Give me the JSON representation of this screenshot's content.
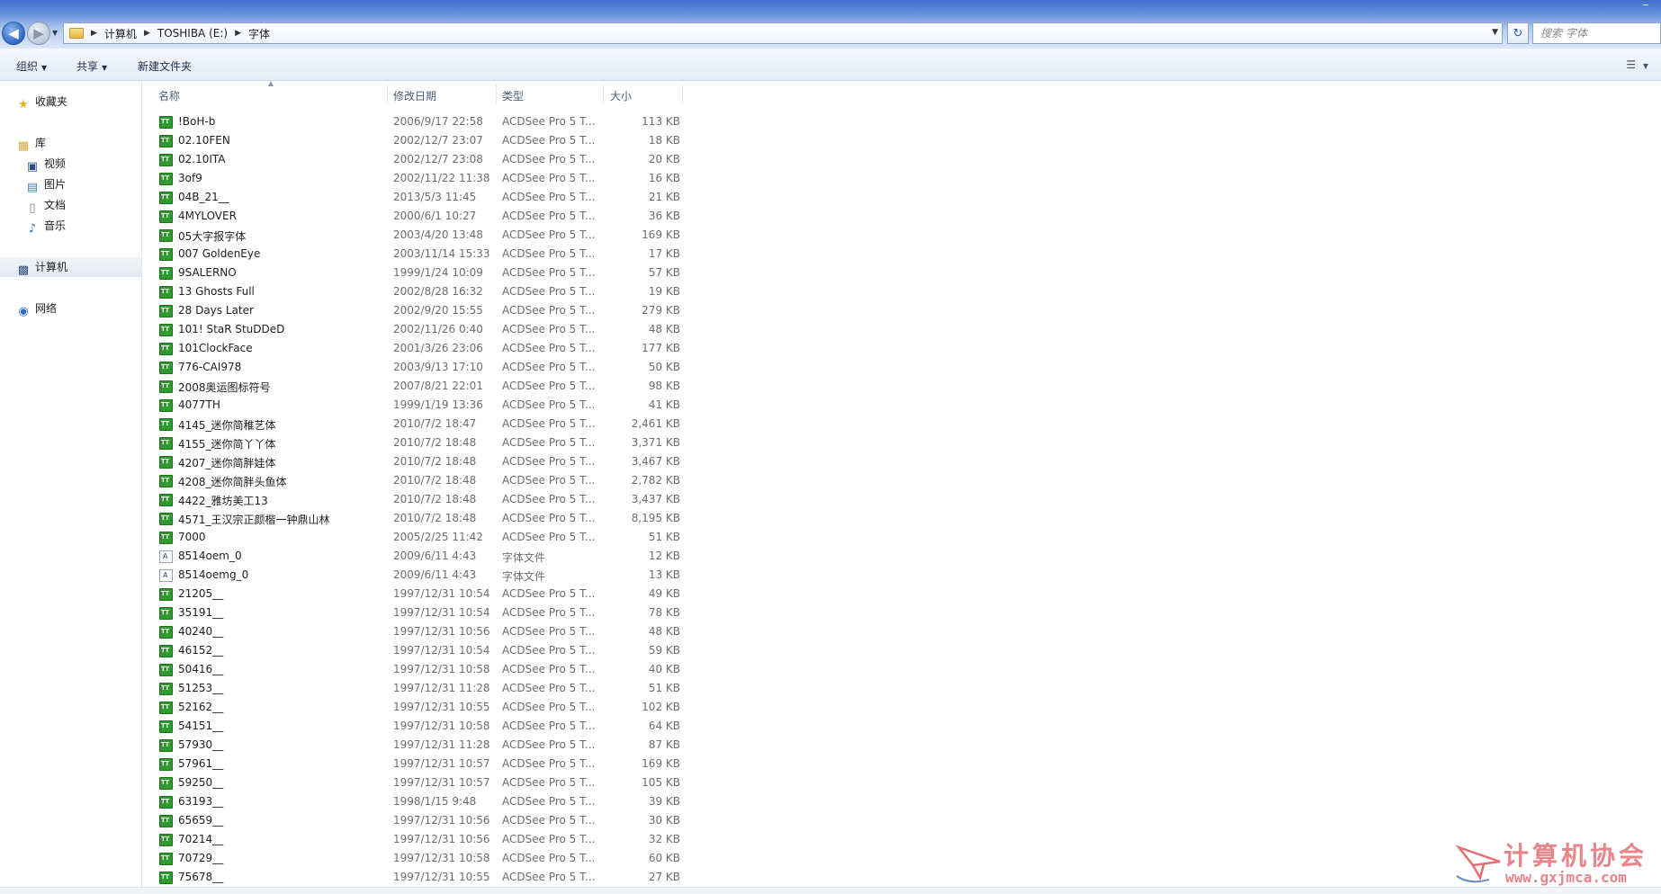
{
  "address": {
    "crumbs": [
      "计算机",
      "TOSHIBA (E:)",
      "字体"
    ],
    "search_placeholder": "搜索 字体"
  },
  "toolbar": {
    "organize": "组织",
    "share": "共享",
    "new_folder": "新建文件夹"
  },
  "nav": {
    "favorites": "收藏夹",
    "libraries": "库",
    "videos": "视频",
    "pictures": "图片",
    "documents": "文档",
    "music": "音乐",
    "computer": "计算机",
    "network": "网络"
  },
  "columns": {
    "name": "名称",
    "date": "修改日期",
    "type": "类型",
    "size": "大小"
  },
  "files": [
    {
      "name": "!BoH-b",
      "date": "2006/9/17 22:58",
      "type": "ACDSee Pro 5 T...",
      "size": "113 KB",
      "icon": "truetype-font-icon"
    },
    {
      "name": "02.10FEN",
      "date": "2002/12/7 23:07",
      "type": "ACDSee Pro 5 T...",
      "size": "18 KB",
      "icon": "truetype-font-icon"
    },
    {
      "name": "02.10ITA",
      "date": "2002/12/7 23:08",
      "type": "ACDSee Pro 5 T...",
      "size": "20 KB",
      "icon": "truetype-font-icon"
    },
    {
      "name": "3of9",
      "date": "2002/11/22 11:38",
      "type": "ACDSee Pro 5 T...",
      "size": "16 KB",
      "icon": "truetype-font-icon"
    },
    {
      "name": "04B_21__",
      "date": "2013/5/3 11:45",
      "type": "ACDSee Pro 5 T...",
      "size": "21 KB",
      "icon": "truetype-font-icon"
    },
    {
      "name": "4MYLOVER",
      "date": "2000/6/1 10:27",
      "type": "ACDSee Pro 5 T...",
      "size": "36 KB",
      "icon": "truetype-font-icon"
    },
    {
      "name": "05大字报字体",
      "date": "2003/4/20 13:48",
      "type": "ACDSee Pro 5 T...",
      "size": "169 KB",
      "icon": "truetype-font-icon"
    },
    {
      "name": "007 GoldenEye",
      "date": "2003/11/14 15:33",
      "type": "ACDSee Pro 5 T...",
      "size": "17 KB",
      "icon": "truetype-font-icon"
    },
    {
      "name": "9SALERNO",
      "date": "1999/1/24 10:09",
      "type": "ACDSee Pro 5 T...",
      "size": "57 KB",
      "icon": "truetype-font-icon"
    },
    {
      "name": "13 Ghosts Full",
      "date": "2002/8/28 16:32",
      "type": "ACDSee Pro 5 T...",
      "size": "19 KB",
      "icon": "truetype-font-icon"
    },
    {
      "name": "28 Days Later",
      "date": "2002/9/20 15:55",
      "type": "ACDSee Pro 5 T...",
      "size": "279 KB",
      "icon": "truetype-font-icon"
    },
    {
      "name": "101! StaR StuDDeD",
      "date": "2002/11/26 0:40",
      "type": "ACDSee Pro 5 T...",
      "size": "48 KB",
      "icon": "truetype-font-icon"
    },
    {
      "name": "101ClockFace",
      "date": "2001/3/26 23:06",
      "type": "ACDSee Pro 5 T...",
      "size": "177 KB",
      "icon": "truetype-font-icon"
    },
    {
      "name": "776-CAI978",
      "date": "2003/9/13 17:10",
      "type": "ACDSee Pro 5 T...",
      "size": "50 KB",
      "icon": "truetype-font-icon"
    },
    {
      "name": "2008奥运图标符号",
      "date": "2007/8/21 22:01",
      "type": "ACDSee Pro 5 T...",
      "size": "98 KB",
      "icon": "truetype-font-icon"
    },
    {
      "name": "4077TH",
      "date": "1999/1/19 13:36",
      "type": "ACDSee Pro 5 T...",
      "size": "41 KB",
      "icon": "truetype-font-icon"
    },
    {
      "name": "4145_迷你简稚艺体",
      "date": "2010/7/2 18:47",
      "type": "ACDSee Pro 5 T...",
      "size": "2,461 KB",
      "icon": "truetype-font-icon"
    },
    {
      "name": "4155_迷你简丫丫体",
      "date": "2010/7/2 18:48",
      "type": "ACDSee Pro 5 T...",
      "size": "3,371 KB",
      "icon": "truetype-font-icon"
    },
    {
      "name": "4207_迷你简胖娃体",
      "date": "2010/7/2 18:48",
      "type": "ACDSee Pro 5 T...",
      "size": "3,467 KB",
      "icon": "truetype-font-icon"
    },
    {
      "name": "4208_迷你简胖头鱼体",
      "date": "2010/7/2 18:48",
      "type": "ACDSee Pro 5 T...",
      "size": "2,782 KB",
      "icon": "truetype-font-icon"
    },
    {
      "name": "4422_雅坊美工13",
      "date": "2010/7/2 18:48",
      "type": "ACDSee Pro 5 T...",
      "size": "3,437 KB",
      "icon": "truetype-font-icon"
    },
    {
      "name": "4571_王汉宗正颜楷一钟鼎山林",
      "date": "2010/7/2 18:48",
      "type": "ACDSee Pro 5 T...",
      "size": "8,195 KB",
      "icon": "truetype-font-icon"
    },
    {
      "name": "7000",
      "date": "2005/2/25 11:42",
      "type": "ACDSee Pro 5 T...",
      "size": "51 KB",
      "icon": "truetype-font-icon"
    },
    {
      "name": "8514oem_0",
      "date": "2009/6/11 4:43",
      "type": "字体文件",
      "size": "12 KB",
      "icon": "font-file-icon"
    },
    {
      "name": "8514oemg_0",
      "date": "2009/6/11 4:43",
      "type": "字体文件",
      "size": "13 KB",
      "icon": "font-file-icon"
    },
    {
      "name": "21205__",
      "date": "1997/12/31 10:54",
      "type": "ACDSee Pro 5 T...",
      "size": "49 KB",
      "icon": "truetype-font-icon"
    },
    {
      "name": "35191__",
      "date": "1997/12/31 10:54",
      "type": "ACDSee Pro 5 T...",
      "size": "78 KB",
      "icon": "truetype-font-icon"
    },
    {
      "name": "40240__",
      "date": "1997/12/31 10:56",
      "type": "ACDSee Pro 5 T...",
      "size": "48 KB",
      "icon": "truetype-font-icon"
    },
    {
      "name": "46152__",
      "date": "1997/12/31 10:54",
      "type": "ACDSee Pro 5 T...",
      "size": "59 KB",
      "icon": "truetype-font-icon"
    },
    {
      "name": "50416__",
      "date": "1997/12/31 10:58",
      "type": "ACDSee Pro 5 T...",
      "size": "40 KB",
      "icon": "truetype-font-icon"
    },
    {
      "name": "51253__",
      "date": "1997/12/31 11:28",
      "type": "ACDSee Pro 5 T...",
      "size": "51 KB",
      "icon": "truetype-font-icon"
    },
    {
      "name": "52162__",
      "date": "1997/12/31 10:55",
      "type": "ACDSee Pro 5 T...",
      "size": "102 KB",
      "icon": "truetype-font-icon"
    },
    {
      "name": "54151__",
      "date": "1997/12/31 10:58",
      "type": "ACDSee Pro 5 T...",
      "size": "64 KB",
      "icon": "truetype-font-icon"
    },
    {
      "name": "57930__",
      "date": "1997/12/31 11:28",
      "type": "ACDSee Pro 5 T...",
      "size": "87 KB",
      "icon": "truetype-font-icon"
    },
    {
      "name": "57961__",
      "date": "1997/12/31 10:57",
      "type": "ACDSee Pro 5 T...",
      "size": "169 KB",
      "icon": "truetype-font-icon"
    },
    {
      "name": "59250__",
      "date": "1997/12/31 10:57",
      "type": "ACDSee Pro 5 T...",
      "size": "105 KB",
      "icon": "truetype-font-icon"
    },
    {
      "name": "63193__",
      "date": "1998/1/15 9:48",
      "type": "ACDSee Pro 5 T...",
      "size": "39 KB",
      "icon": "truetype-font-icon"
    },
    {
      "name": "65659__",
      "date": "1997/12/31 10:56",
      "type": "ACDSee Pro 5 T...",
      "size": "30 KB",
      "icon": "truetype-font-icon"
    },
    {
      "name": "70214__",
      "date": "1997/12/31 10:56",
      "type": "ACDSee Pro 5 T...",
      "size": "32 KB",
      "icon": "truetype-font-icon"
    },
    {
      "name": "70729__",
      "date": "1997/12/31 10:58",
      "type": "ACDSee Pro 5 T...",
      "size": "60 KB",
      "icon": "truetype-font-icon"
    },
    {
      "name": "75678__",
      "date": "1997/12/31 10:55",
      "type": "ACDSee Pro 5 T...",
      "size": "27 KB",
      "icon": "truetype-font-icon"
    }
  ],
  "watermark": {
    "title": "计算机协会",
    "url": "www.gxjmca.com"
  }
}
